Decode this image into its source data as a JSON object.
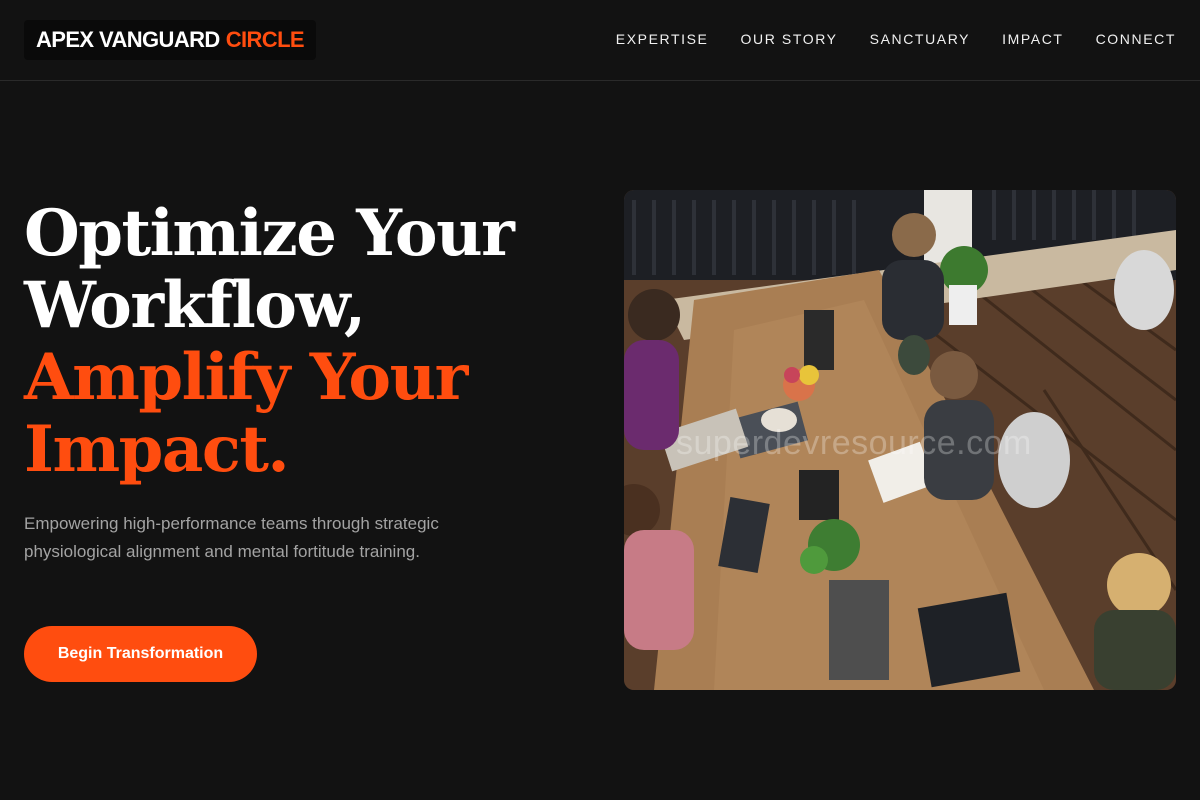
{
  "brand": {
    "name": "APEX VANGUARD",
    "accent": "CIRCLE"
  },
  "nav": {
    "items": [
      "EXPERTISE",
      "OUR STORY",
      "SANCTUARY",
      "IMPACT",
      "CONNECT"
    ]
  },
  "hero": {
    "title_line1": "Optimize Your",
    "title_line2": "Workflow,",
    "title_line3": "Amplify Your",
    "title_line4": "Impact.",
    "subtitle": "Empowering high-performance teams through strategic physiological alignment and mental fortitude training.",
    "cta_label": "Begin Transformation"
  },
  "image": {
    "alt": "Team working together around a long wooden table",
    "watermark": "superdevresource.com"
  },
  "colors": {
    "background": "#121212",
    "accent": "#ff4d0f",
    "text": "#ffffff",
    "muted": "#a3a3a3"
  }
}
